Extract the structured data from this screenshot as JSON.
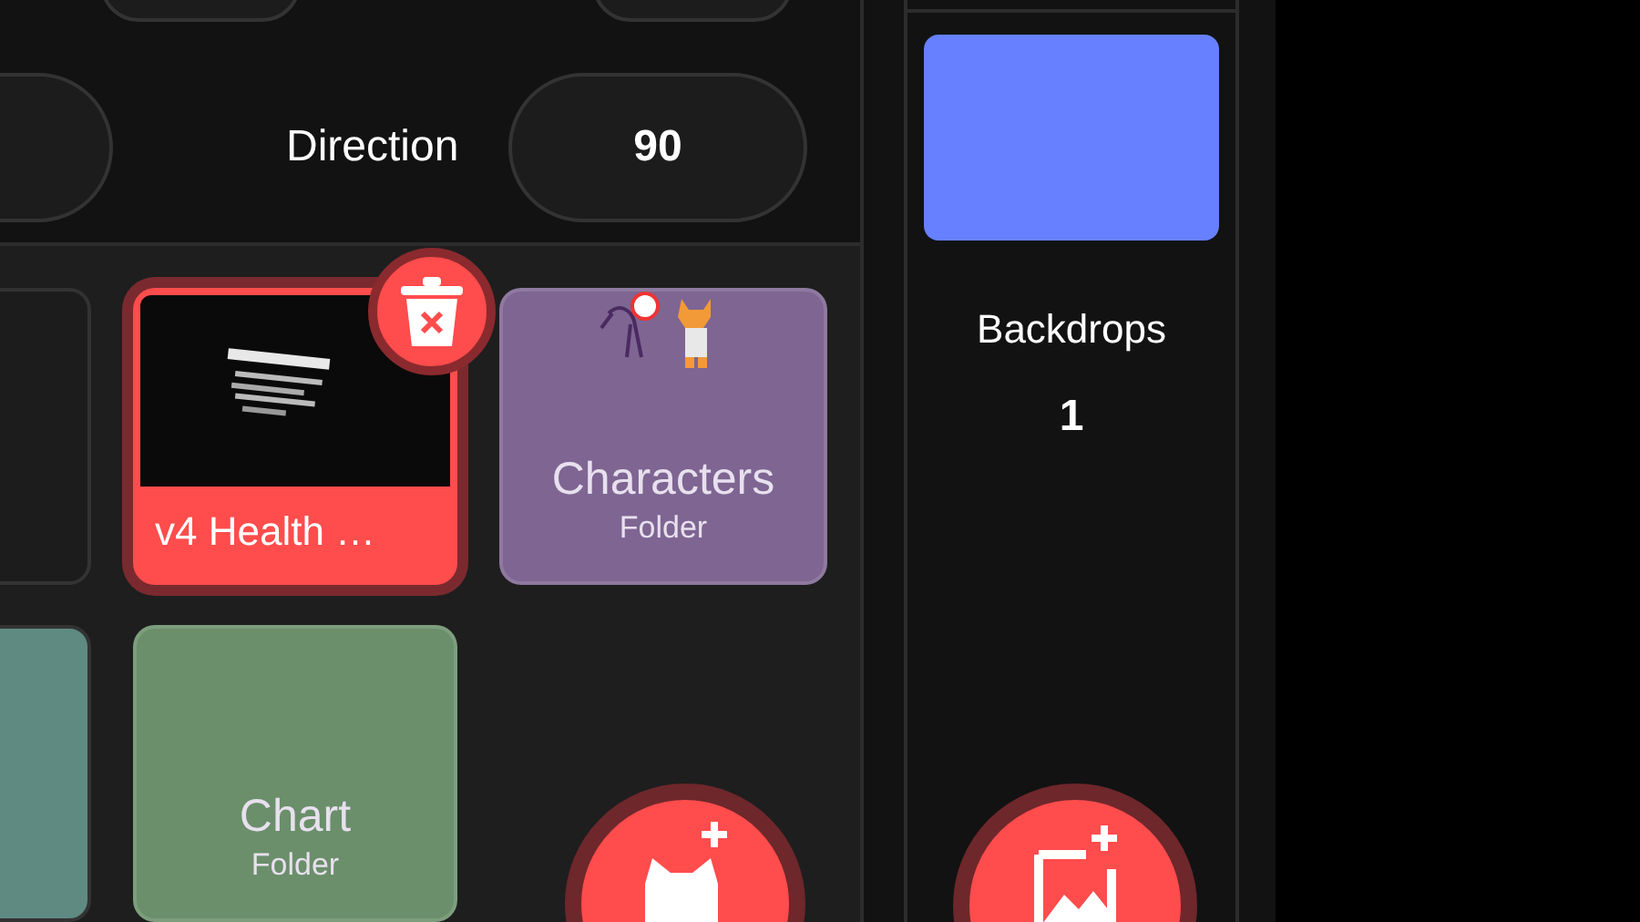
{
  "sprite_info": {
    "fields": [
      {
        "label": "Direction",
        "value": "90"
      }
    ]
  },
  "sprites": [
    {
      "kind": "cut",
      "color": "#1c1c1c"
    },
    {
      "kind": "sprite",
      "name": "v4 Health …",
      "selected": true
    },
    {
      "kind": "folder",
      "name": "Characters",
      "subtitle": "Folder",
      "color": "#7e6592"
    },
    {
      "kind": "cut",
      "color": "#5e8a82"
    },
    {
      "kind": "folder",
      "name": "Chart",
      "subtitle": "Folder",
      "color": "#6a8f6a"
    }
  ],
  "stage": {
    "label": "Backdrops",
    "count": "1"
  }
}
